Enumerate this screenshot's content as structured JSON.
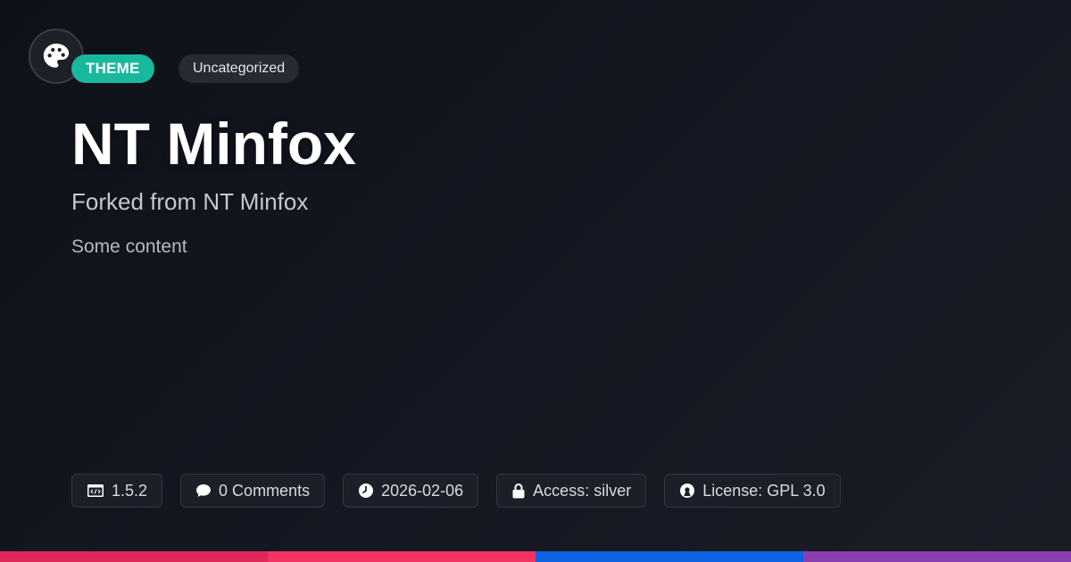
{
  "logo": {
    "icon": "palette-icon"
  },
  "badges": {
    "type": "THEME",
    "category": "Uncategorized"
  },
  "title": "NT Minfox",
  "subtitle": "Forked from NT Minfox",
  "content": "Some content",
  "meta": [
    {
      "icon": "code-icon",
      "text": "1.5.2"
    },
    {
      "icon": "comment-icon",
      "text": "0 Comments"
    },
    {
      "icon": "clock-icon",
      "text": "2026-02-06"
    },
    {
      "icon": "lock-icon",
      "text": "Access: silver"
    },
    {
      "icon": "license-icon",
      "text": "License: GPL 3.0"
    }
  ],
  "colors": {
    "accent": "#19b89c",
    "stripe": [
      "#e0285a",
      "#f33462",
      "#0d63e3",
      "#8a3fb0"
    ]
  }
}
